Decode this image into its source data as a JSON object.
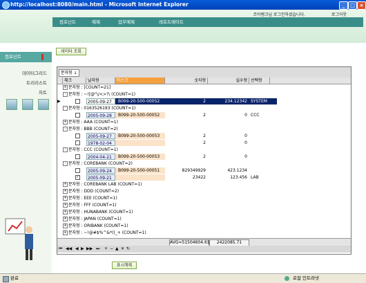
{
  "window": {
    "title": "http://localhost:8080/main.html - Microsoft Internet Explorer"
  },
  "header": {
    "user_text": "코아뱅크님 로그인하셨습니다.",
    "logout_label": "로그아웃",
    "nav": [
      "컴포넌트",
      "예제",
      "업무예제",
      "레포트메이트"
    ]
  },
  "left": {
    "title": "컴포넌트",
    "links": [
      "데이터그리드",
      "트리리스트",
      "차트"
    ]
  },
  "content": {
    "section_button": "데이터 조회",
    "bottom_button": "표시해제",
    "group_chip": "문자형",
    "columns": [
      "체크",
      "날자형",
      "마스크",
      "숫자형",
      "실수형",
      "선택형"
    ],
    "rows": [
      {
        "type": "group",
        "text": "문자형 : [COUNT=21]",
        "mark": "+"
      },
      {
        "type": "group",
        "text": "문자형 : ~![@\"\\/<>?\\ (COUNT=1)",
        "mark": "-"
      },
      {
        "type": "data",
        "checked": false,
        "date": "2005-09-27",
        "mask": "B099-20-500-00052",
        "num": "2",
        "real": "234.12342",
        "select": "SYSTEM",
        "selected": true
      },
      {
        "type": "group",
        "text": "문자형 : 0163526193 (COUNT=1)",
        "mark": "-"
      },
      {
        "type": "data",
        "checked": false,
        "date": "2005-09-28",
        "mask": "B099-20-500-00052",
        "num": "2",
        "real": "0",
        "select": "CCC"
      },
      {
        "type": "group",
        "text": "문자형 : AAA (COUNT=1)",
        "mark": "+"
      },
      {
        "type": "group",
        "text": "문자형 : BBB (COUNT=2)",
        "mark": "-"
      },
      {
        "type": "data",
        "checked": false,
        "date": "2005-09-27",
        "mask": "B099-20-500-00053",
        "num": "2",
        "real": "0",
        "select": ""
      },
      {
        "type": "data",
        "checked": false,
        "date": "1978-02-04",
        "mask": "",
        "num": "2",
        "real": "0",
        "select": ""
      },
      {
        "type": "group",
        "text": "문자형 : CCC (COUNT=1)",
        "mark": "-"
      },
      {
        "type": "data",
        "checked": false,
        "date": "2004-04-21",
        "mask": "B099-20-500-00053",
        "num": "2",
        "real": "0",
        "select": ""
      },
      {
        "type": "group",
        "text": "문자형 : COREBANK (COUNT=2)",
        "mark": "-"
      },
      {
        "type": "data",
        "checked": false,
        "date": "2005-09-24",
        "mask": "B099-20-500-00051",
        "num": "829349929",
        "real": "423.1234",
        "select": ""
      },
      {
        "type": "data",
        "checked": true,
        "date": "2005-09-21",
        "mask": "",
        "num": "23422",
        "real": "123.456",
        "select": "LAB"
      },
      {
        "type": "group",
        "text": "문자형 : COREBANK LAB (COUNT=1)",
        "mark": "+"
      },
      {
        "type": "group",
        "text": "문자형 : DDD (COUNT=2)",
        "mark": "+"
      },
      {
        "type": "group",
        "text": "문자형 : EEE (COUNT=1)",
        "mark": "+"
      },
      {
        "type": "group",
        "text": "문자형 : FFF (COUNT=1)",
        "mark": "+"
      },
      {
        "type": "group",
        "text": "문자형 : HUNABANK (COUNT=1)",
        "mark": "+"
      },
      {
        "type": "group",
        "text": "문자형 : JAPAN (COUNT=1)",
        "mark": "+"
      },
      {
        "type": "group",
        "text": "문자형 : ORIBANK (COUNT=1)",
        "mark": "+"
      },
      {
        "type": "group",
        "text": "문자형 : ~!@#$%^&*()_+ (COUNT=1)",
        "mark": "+"
      }
    ],
    "footer": {
      "avg": "AVG=51504604.61",
      "sum": "2422085.71"
    }
  },
  "status": {
    "left": "완료",
    "right": "로컬 인트라넷"
  }
}
